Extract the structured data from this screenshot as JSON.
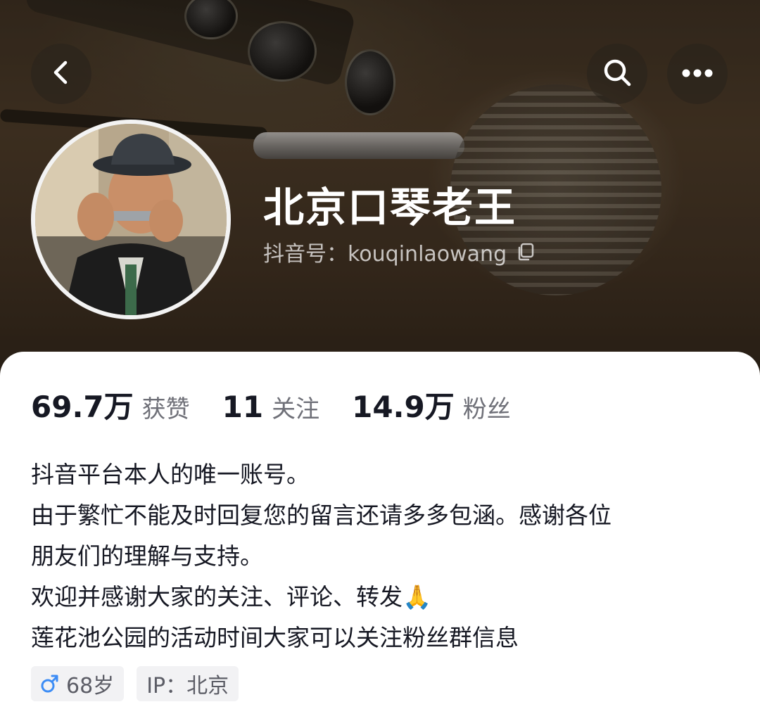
{
  "header": {
    "back_icon": "chevron-left-icon",
    "search_icon": "search-icon",
    "more_icon": "more-horizontal-icon"
  },
  "profile": {
    "display_name": "北京口琴老王",
    "account_id_label": "抖音号：kouqinlaowang",
    "copy_icon": "copy-icon"
  },
  "stats": [
    {
      "value": "69.7万",
      "label": "获赞"
    },
    {
      "value": "11",
      "label": "关注"
    },
    {
      "value": "14.9万",
      "label": "粉丝"
    }
  ],
  "bio": {
    "lines": [
      "抖音平台本人的唯一账号。",
      "由于繁忙不能及时回复您的留言还请多多包涵。感谢各位",
      "朋友们的理解与支持。",
      "欢迎并感谢大家的关注、评论、转发",
      "莲花池公园的活动时间大家可以关注粉丝群信息"
    ],
    "emoji": "🙏"
  },
  "tags": {
    "age": "68岁",
    "ip": "IP：北京",
    "gender_icon": "male-icon",
    "gender_color": "#3c8cf5"
  },
  "colors": {
    "text_primary": "#161823",
    "text_secondary": "#6f7078",
    "tag_bg": "#f2f2f4"
  }
}
